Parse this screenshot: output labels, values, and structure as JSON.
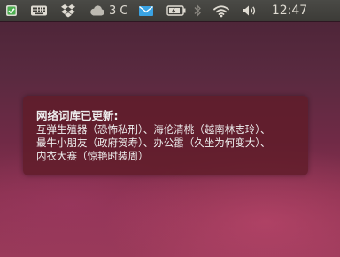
{
  "panel": {
    "weather_text": "3 C",
    "clock": "12:47"
  },
  "icons": {
    "update": "update-checkmark-icon",
    "keyboard": "keyboard-icon",
    "dropbox": "dropbox-icon",
    "weather": "weather-cloud-icon",
    "mail": "mail-envelope-icon",
    "battery": "battery-icon",
    "bluetooth": "bluetooth-icon",
    "wifi": "wifi-signal-icon",
    "volume": "volume-speaker-icon"
  },
  "colors": {
    "panel_text": "#dfdbd2",
    "mail_accent": "#3aa3e3",
    "update_accent": "#4caf50",
    "notification_bg": "#5f1c28"
  },
  "notification": {
    "title": "网络词库已更新:",
    "body": "互弹生殖器（恐怖私刑）、海伦清桃（越南林志玲）、\n最牛小朋友（政府贺寿）、办公嚣（久坐为何变大）、\n内衣大赛（惊艳时装周）"
  }
}
